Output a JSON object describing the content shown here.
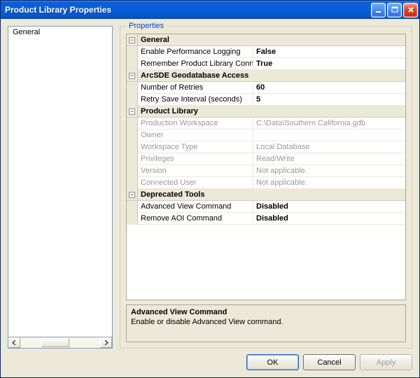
{
  "titlebar": {
    "title": "Product Library Properties"
  },
  "tree": {
    "items": [
      "General"
    ]
  },
  "groupbox": {
    "label": "Properties"
  },
  "propgrid": {
    "categories": [
      {
        "name": "General",
        "props": [
          {
            "key": "Enable Performance Logging",
            "val": "False",
            "readonly": false
          },
          {
            "key": "Remember Product Library Connection",
            "val": "True",
            "readonly": false
          }
        ]
      },
      {
        "name": "ArcSDE Geodatabase Access",
        "props": [
          {
            "key": "Number of Retries",
            "val": "60",
            "readonly": false
          },
          {
            "key": "Retry Save Interval (seconds)",
            "val": "5",
            "readonly": false
          }
        ]
      },
      {
        "name": "Product Library",
        "props": [
          {
            "key": "Production Workspace",
            "val": "C:\\Data\\Southern California.gdb",
            "readonly": true
          },
          {
            "key": "Owner",
            "val": "",
            "readonly": true
          },
          {
            "key": "Workspace Type",
            "val": "Local Database",
            "readonly": true
          },
          {
            "key": "Privileges",
            "val": "Read/Write",
            "readonly": true
          },
          {
            "key": "Version",
            "val": "Not applicable.",
            "readonly": true
          },
          {
            "key": "Connected User",
            "val": "Not applicable.",
            "readonly": true
          }
        ]
      },
      {
        "name": "Deprecated Tools",
        "props": [
          {
            "key": "Advanced View Command",
            "val": "Disabled",
            "readonly": false
          },
          {
            "key": "Remove AOI Command",
            "val": "Disabled",
            "readonly": false
          }
        ]
      }
    ]
  },
  "description": {
    "title": "Advanced View Command",
    "text": "Enable or disable Advanced View command."
  },
  "buttons": {
    "ok": "OK",
    "cancel": "Cancel",
    "apply": "Apply"
  },
  "expander_glyph": "−"
}
